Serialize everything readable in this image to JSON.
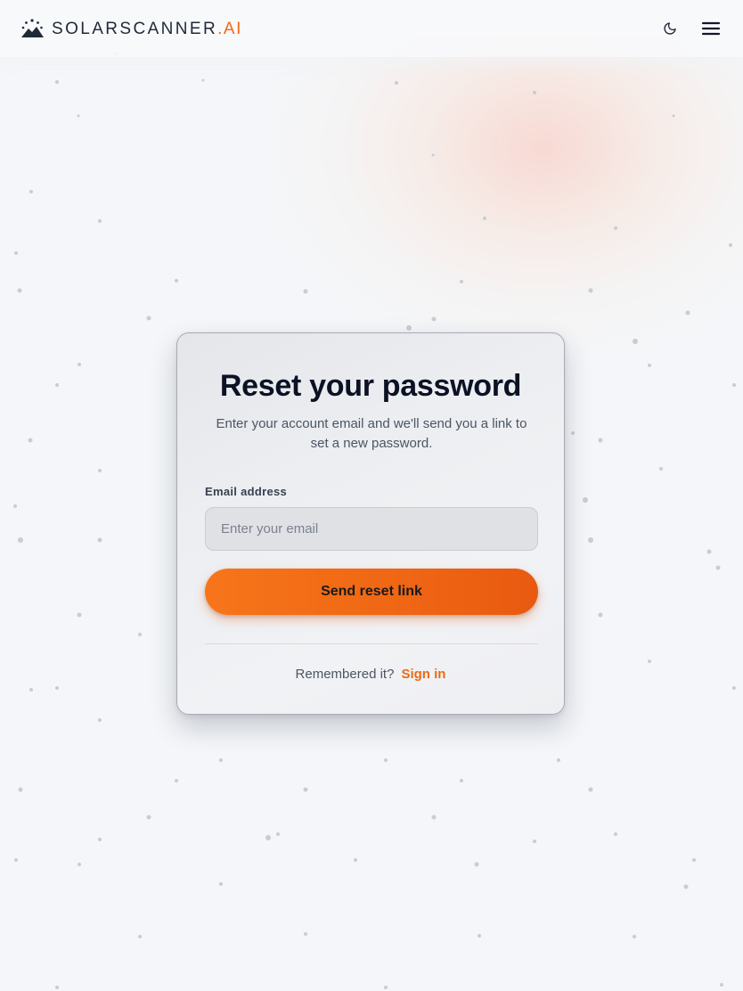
{
  "header": {
    "brand_name": "SOLARSCANNER",
    "brand_suffix": ".AI",
    "icons": {
      "logo": "sun-mountain-icon",
      "theme_toggle": "moon-icon",
      "menu": "hamburger-menu-icon"
    }
  },
  "form": {
    "title": "Reset your password",
    "subtitle": "Enter your account email and we'll send you a link to set a new password.",
    "email_label": "Email address",
    "email_placeholder": "Enter your email",
    "email_value": "",
    "submit_label": "Send reset link",
    "footer_text": "Remembered it?",
    "signin_label": "Sign in"
  },
  "colors": {
    "accent": "#f06a12",
    "button_start": "#f7751a",
    "button_end": "#e85a10",
    "background": "#f4f6f9",
    "text_dark": "#0b1224"
  }
}
